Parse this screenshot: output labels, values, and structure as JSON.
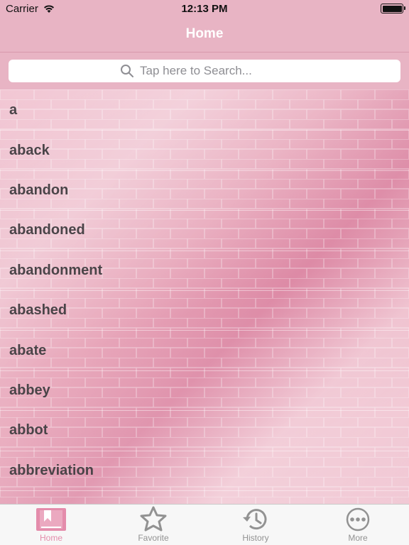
{
  "status_bar": {
    "carrier": "Carrier",
    "time": "12:13 PM"
  },
  "nav": {
    "title": "Home"
  },
  "search": {
    "placeholder": "Tap here to Search..."
  },
  "words": [
    "a",
    "aback",
    "abandon",
    "abandoned",
    "abandonment",
    "abashed",
    "abate",
    "abbey",
    "abbot",
    "abbreviation"
  ],
  "tabs": [
    {
      "label": "Home",
      "icon": "bookmark-book-icon",
      "active": true
    },
    {
      "label": "Favorite",
      "icon": "star-icon",
      "active": false
    },
    {
      "label": "History",
      "icon": "history-clock-icon",
      "active": false
    },
    {
      "label": "More",
      "icon": "more-dots-icon",
      "active": false
    }
  ],
  "colors": {
    "accent": "#e48cab",
    "nav_bg": "#e8b4c4",
    "text": "#4a4448"
  }
}
